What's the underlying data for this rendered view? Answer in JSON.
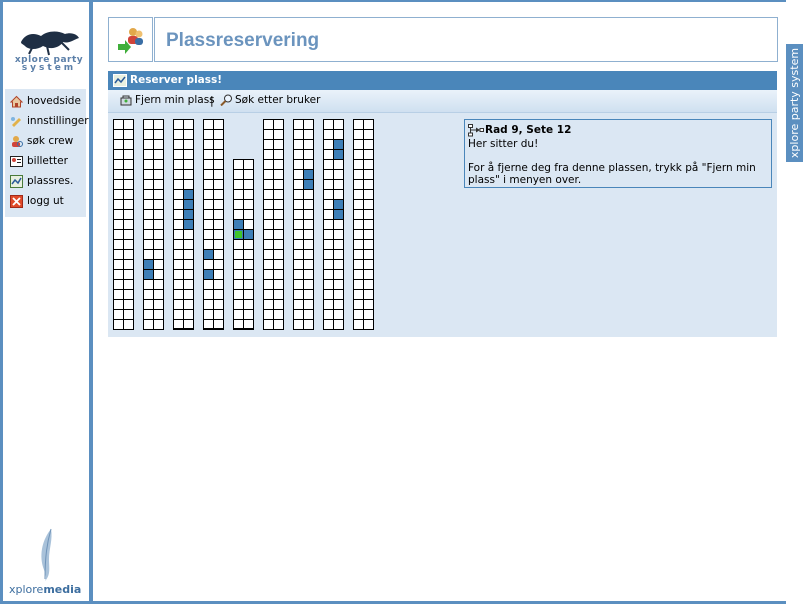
{
  "sidebar": {
    "logo_line1": "xplore party",
    "logo_line2": "system",
    "items": [
      {
        "label": "hovedside",
        "icon": "home-icon"
      },
      {
        "label": "innstillinger",
        "icon": "settings-icon"
      },
      {
        "label": "søk crew",
        "icon": "crew-search-icon"
      },
      {
        "label": "billetter",
        "icon": "ticket-icon"
      },
      {
        "label": "plassres.",
        "icon": "seat-reservation-icon"
      },
      {
        "label": "logg ut",
        "icon": "logout-icon"
      }
    ],
    "brand_prefix": "xplore",
    "brand_suffix": "media"
  },
  "right_tab": "xplore party system",
  "header": {
    "title": "Plassreservering",
    "icon": "users-reservation-icon"
  },
  "panel": {
    "title": "Reserver plass!",
    "toolbar": {
      "remove_label": "Fjern min plass",
      "separator": "|",
      "search_label": "Søk etter bruker"
    }
  },
  "info": {
    "title": "Rad 9, Sete 12",
    "line1": "Her sitter du!",
    "line2": "For å fjerne deg fra denne plassen, trykk på \"Fjern min plass\" i menyen over."
  },
  "seat_map": {
    "rows": [
      {
        "row": 1,
        "seats": 21,
        "taken": [],
        "mine": null
      },
      {
        "row": 2,
        "seats": 21,
        "taken": [
          [
            14,
            0
          ],
          [
            15,
            0
          ]
        ],
        "mine": null
      },
      {
        "row": 3,
        "seats": 21,
        "taken": [
          [
            7,
            1
          ],
          [
            8,
            1
          ],
          [
            9,
            1
          ],
          [
            10,
            1
          ]
        ],
        "mine": null
      },
      {
        "row": 4,
        "seats": 21,
        "taken": [
          [
            13,
            0
          ],
          [
            15,
            0
          ]
        ],
        "mine": null
      },
      {
        "row": 5,
        "seats": 17,
        "taken": [
          [
            6,
            0
          ],
          [
            7,
            1
          ]
        ],
        "mine": [
          7,
          0
        ]
      },
      {
        "row": 6,
        "seats": 21,
        "taken": [],
        "mine": null
      },
      {
        "row": 7,
        "seats": 21,
        "taken": [
          [
            5,
            1
          ],
          [
            6,
            1
          ]
        ],
        "mine": null
      },
      {
        "row": 8,
        "seats": 21,
        "taken": [
          [
            2,
            1
          ],
          [
            3,
            1
          ],
          [
            8,
            1
          ],
          [
            9,
            1
          ]
        ],
        "mine": null
      },
      {
        "row": 9,
        "seats": 21,
        "taken": [],
        "mine": null
      }
    ],
    "colors": {
      "taken": "#3d7fb8",
      "mine": "#3fc52b",
      "free": "#ffffff"
    }
  }
}
